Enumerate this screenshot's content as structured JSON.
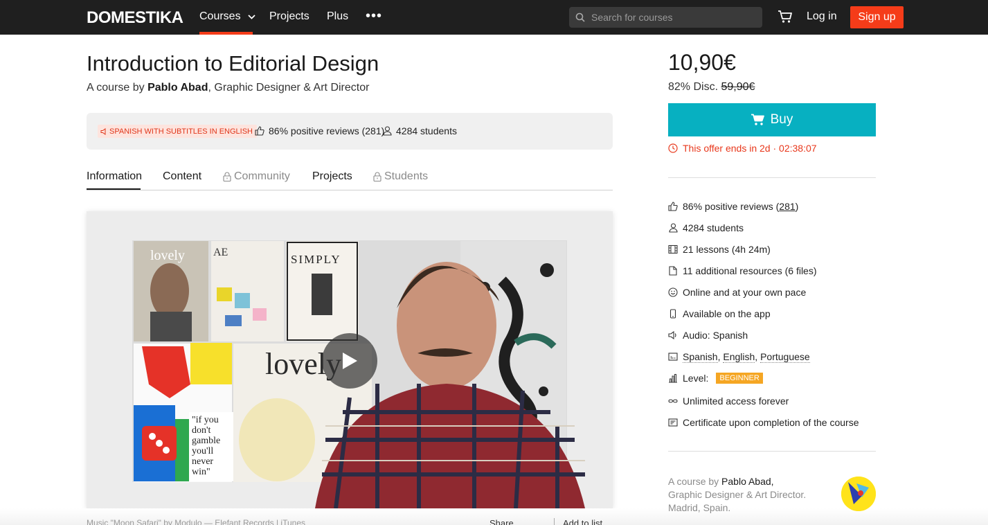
{
  "nav": {
    "logo": "DOMESTIKA",
    "courses": "Courses",
    "projects": "Projects",
    "plus": "Plus",
    "more": "•••",
    "search_placeholder": "Search for courses",
    "login": "Log in",
    "signup": "Sign up"
  },
  "course": {
    "title": "Introduction to Editorial Design",
    "by_prefix": "A course by",
    "author": "Pablo Abad",
    "author_role": ", Graphic Designer & Art Director",
    "language_badge": "SPANISH WITH SUBTITLES IN ENGLISH",
    "reviews": "86% positive reviews (281)",
    "students": "4284 students"
  },
  "tabs": [
    {
      "label": "Information",
      "locked": false,
      "active": true
    },
    {
      "label": "Content",
      "locked": false
    },
    {
      "label": "Community",
      "locked": true
    },
    {
      "label": "Projects",
      "locked": false
    },
    {
      "label": "Students",
      "locked": true
    }
  ],
  "video": {
    "music_credit": "Music \"Moon Safari\" by Modulo — Elefant Records | iTunes",
    "share": "Share",
    "add_list": "Add to list"
  },
  "purchase": {
    "price": "10,90€",
    "discount": "82% Disc.",
    "original_price": "59,90€",
    "buy": "Buy",
    "offer": "This offer ends in 2d · 02:38:07"
  },
  "features": {
    "reviews_pre": "86% positive reviews (",
    "reviews_count": "281",
    "reviews_post": ")",
    "students": "4284 students",
    "lessons": "21 lessons (4h 24m)",
    "resources": "11 additional resources (6 files)",
    "pace": "Online and at your own pace",
    "app": "Available on the app",
    "audio": "Audio: Spanish",
    "subtitle_1": "Spanish",
    "subtitle_2": "English",
    "subtitle_3": "Portuguese",
    "level_label": "Level:",
    "level": "BEGINNER",
    "access": "Unlimited access forever",
    "certificate": "Certificate upon completion of the course"
  },
  "author_box": {
    "prefix": "A course by",
    "name": "Pablo Abad,",
    "role": "Graphic Designer & Art Director.",
    "location": "Madrid, Spain."
  },
  "colors": {
    "brand_red": "#f53c19",
    "buy_teal": "#07b0c1",
    "offer_red": "#e8371b",
    "level_orange": "#f5a623"
  }
}
